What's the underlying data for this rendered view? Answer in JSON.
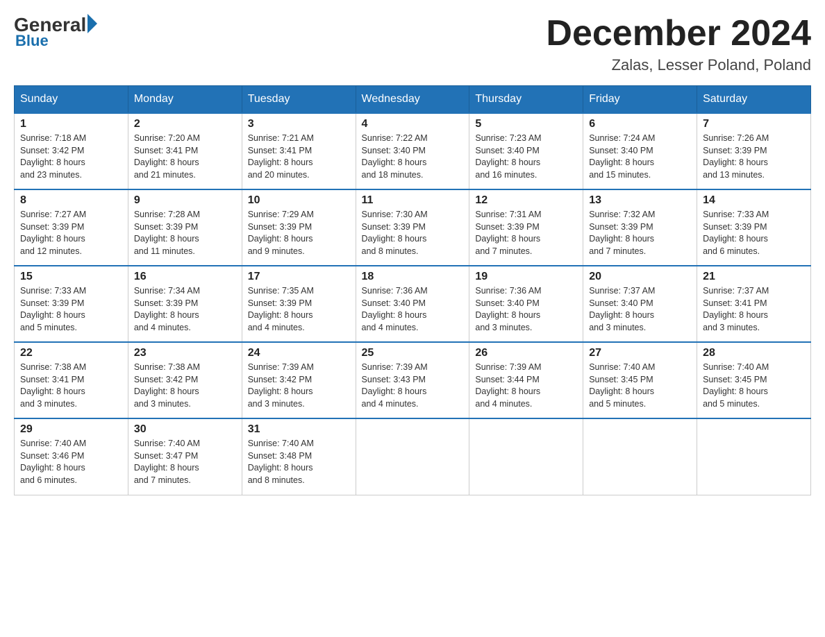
{
  "header": {
    "logo": {
      "general": "General",
      "blue": "Blue",
      "tagline": "Blue"
    },
    "title": "December 2024",
    "location": "Zalas, Lesser Poland, Poland"
  },
  "days_of_week": [
    "Sunday",
    "Monday",
    "Tuesday",
    "Wednesday",
    "Thursday",
    "Friday",
    "Saturday"
  ],
  "weeks": [
    [
      {
        "day": "1",
        "sunrise": "7:18 AM",
        "sunset": "3:42 PM",
        "daylight": "8 hours and 23 minutes."
      },
      {
        "day": "2",
        "sunrise": "7:20 AM",
        "sunset": "3:41 PM",
        "daylight": "8 hours and 21 minutes."
      },
      {
        "day": "3",
        "sunrise": "7:21 AM",
        "sunset": "3:41 PM",
        "daylight": "8 hours and 20 minutes."
      },
      {
        "day": "4",
        "sunrise": "7:22 AM",
        "sunset": "3:40 PM",
        "daylight": "8 hours and 18 minutes."
      },
      {
        "day": "5",
        "sunrise": "7:23 AM",
        "sunset": "3:40 PM",
        "daylight": "8 hours and 16 minutes."
      },
      {
        "day": "6",
        "sunrise": "7:24 AM",
        "sunset": "3:40 PM",
        "daylight": "8 hours and 15 minutes."
      },
      {
        "day": "7",
        "sunrise": "7:26 AM",
        "sunset": "3:39 PM",
        "daylight": "8 hours and 13 minutes."
      }
    ],
    [
      {
        "day": "8",
        "sunrise": "7:27 AM",
        "sunset": "3:39 PM",
        "daylight": "8 hours and 12 minutes."
      },
      {
        "day": "9",
        "sunrise": "7:28 AM",
        "sunset": "3:39 PM",
        "daylight": "8 hours and 11 minutes."
      },
      {
        "day": "10",
        "sunrise": "7:29 AM",
        "sunset": "3:39 PM",
        "daylight": "8 hours and 9 minutes."
      },
      {
        "day": "11",
        "sunrise": "7:30 AM",
        "sunset": "3:39 PM",
        "daylight": "8 hours and 8 minutes."
      },
      {
        "day": "12",
        "sunrise": "7:31 AM",
        "sunset": "3:39 PM",
        "daylight": "8 hours and 7 minutes."
      },
      {
        "day": "13",
        "sunrise": "7:32 AM",
        "sunset": "3:39 PM",
        "daylight": "8 hours and 7 minutes."
      },
      {
        "day": "14",
        "sunrise": "7:33 AM",
        "sunset": "3:39 PM",
        "daylight": "8 hours and 6 minutes."
      }
    ],
    [
      {
        "day": "15",
        "sunrise": "7:33 AM",
        "sunset": "3:39 PM",
        "daylight": "8 hours and 5 minutes."
      },
      {
        "day": "16",
        "sunrise": "7:34 AM",
        "sunset": "3:39 PM",
        "daylight": "8 hours and 4 minutes."
      },
      {
        "day": "17",
        "sunrise": "7:35 AM",
        "sunset": "3:39 PM",
        "daylight": "8 hours and 4 minutes."
      },
      {
        "day": "18",
        "sunrise": "7:36 AM",
        "sunset": "3:40 PM",
        "daylight": "8 hours and 4 minutes."
      },
      {
        "day": "19",
        "sunrise": "7:36 AM",
        "sunset": "3:40 PM",
        "daylight": "8 hours and 3 minutes."
      },
      {
        "day": "20",
        "sunrise": "7:37 AM",
        "sunset": "3:40 PM",
        "daylight": "8 hours and 3 minutes."
      },
      {
        "day": "21",
        "sunrise": "7:37 AM",
        "sunset": "3:41 PM",
        "daylight": "8 hours and 3 minutes."
      }
    ],
    [
      {
        "day": "22",
        "sunrise": "7:38 AM",
        "sunset": "3:41 PM",
        "daylight": "8 hours and 3 minutes."
      },
      {
        "day": "23",
        "sunrise": "7:38 AM",
        "sunset": "3:42 PM",
        "daylight": "8 hours and 3 minutes."
      },
      {
        "day": "24",
        "sunrise": "7:39 AM",
        "sunset": "3:42 PM",
        "daylight": "8 hours and 3 minutes."
      },
      {
        "day": "25",
        "sunrise": "7:39 AM",
        "sunset": "3:43 PM",
        "daylight": "8 hours and 4 minutes."
      },
      {
        "day": "26",
        "sunrise": "7:39 AM",
        "sunset": "3:44 PM",
        "daylight": "8 hours and 4 minutes."
      },
      {
        "day": "27",
        "sunrise": "7:40 AM",
        "sunset": "3:45 PM",
        "daylight": "8 hours and 5 minutes."
      },
      {
        "day": "28",
        "sunrise": "7:40 AM",
        "sunset": "3:45 PM",
        "daylight": "8 hours and 5 minutes."
      }
    ],
    [
      {
        "day": "29",
        "sunrise": "7:40 AM",
        "sunset": "3:46 PM",
        "daylight": "8 hours and 6 minutes."
      },
      {
        "day": "30",
        "sunrise": "7:40 AM",
        "sunset": "3:47 PM",
        "daylight": "8 hours and 7 minutes."
      },
      {
        "day": "31",
        "sunrise": "7:40 AM",
        "sunset": "3:48 PM",
        "daylight": "8 hours and 8 minutes."
      },
      null,
      null,
      null,
      null
    ]
  ],
  "labels": {
    "sunrise": "Sunrise:",
    "sunset": "Sunset:",
    "daylight": "Daylight:"
  }
}
